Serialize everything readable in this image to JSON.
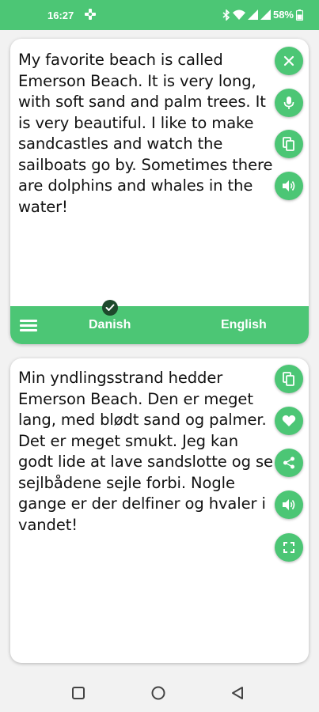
{
  "status_bar": {
    "time": "16:27",
    "battery": "58%"
  },
  "source": {
    "text": "My favorite beach is called Emerson Beach. It is very long, with soft sand and palm trees. It is very beautiful. I like to make sandcastles and watch the sailboats go by. Sometimes there are dolphins and whales in the water!",
    "actions": [
      "close-icon",
      "microphone-icon",
      "copy-icon",
      "speaker-icon"
    ]
  },
  "language_bar": {
    "source_language": "Danish",
    "target_language": "English"
  },
  "target": {
    "text": "Min yndlingsstrand hedder Emerson Beach. Den er meget lang, med blødt sand og palmer. Det er meget smukt. Jeg kan godt lide at lave sandslotte og se sejlbådene sejle forbi. Nogle gange er der delfiner og hvaler i vandet!",
    "actions": [
      "copy-icon",
      "heart-icon",
      "share-icon",
      "speaker-icon",
      "fullscreen-icon"
    ]
  },
  "colors": {
    "accent": "#4cc675",
    "badge": "#1e4a2c",
    "card": "#ffffff",
    "background": "#f2f2f2"
  }
}
